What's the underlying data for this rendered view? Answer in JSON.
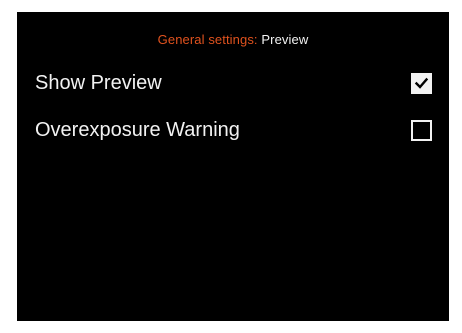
{
  "header": {
    "section": "General settings:",
    "page": "Preview"
  },
  "settings": [
    {
      "label": "Show Preview",
      "checked": true
    },
    {
      "label": "Overexposure Warning",
      "checked": false
    }
  ],
  "colors": {
    "background": "#000000",
    "accent": "#e0521e",
    "text": "#f2f2f2"
  }
}
